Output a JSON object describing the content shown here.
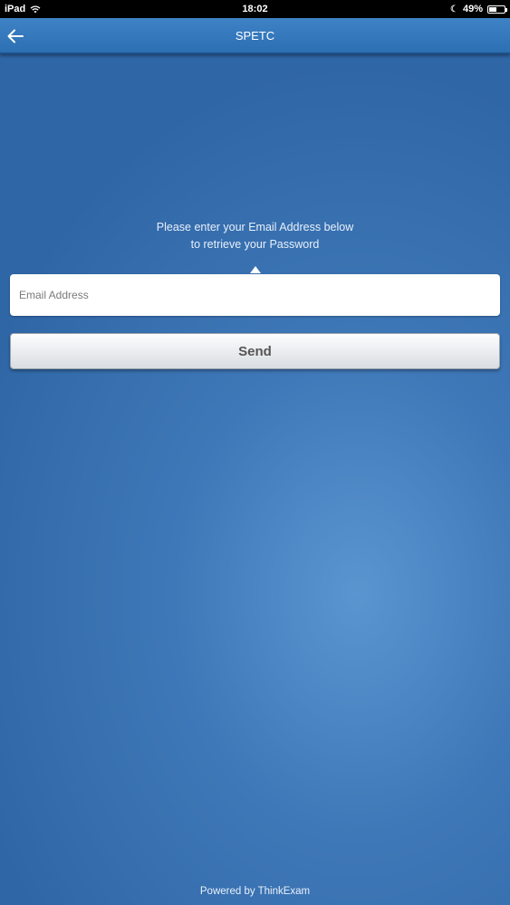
{
  "status_bar": {
    "device": "iPad",
    "time": "18:02",
    "battery": "49%",
    "icons": [
      "wifi-icon",
      "moon-icon",
      "battery-icon"
    ]
  },
  "nav": {
    "title": "SPETC",
    "back_icon": "arrow-left-icon"
  },
  "form": {
    "instruction_line1": "Please enter your Email Address below",
    "instruction_line2": "to retrieve your Password",
    "email_placeholder": "Email Address",
    "email_value": "",
    "send_label": "Send"
  },
  "footer": {
    "text": "Powered by ThinkExam"
  },
  "colors": {
    "nav_bg": "#3479bd",
    "background": "#3f78b8",
    "button_text": "#555555"
  }
}
